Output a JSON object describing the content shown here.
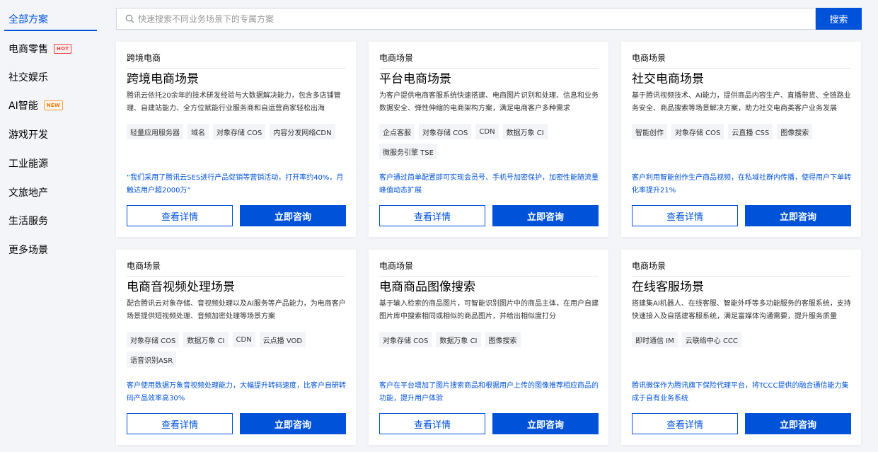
{
  "sidebar": {
    "items": [
      {
        "label": "全部方案"
      },
      {
        "label": "电商零售",
        "badge": "HOT"
      },
      {
        "label": "社交娱乐"
      },
      {
        "label": "AI智能",
        "badge": "NEW"
      },
      {
        "label": "游戏开发"
      },
      {
        "label": "工业能源"
      },
      {
        "label": "文旅地产"
      },
      {
        "label": "生活服务"
      },
      {
        "label": "更多场景"
      }
    ]
  },
  "search": {
    "placeholder": "快速搜索不同业务场景下的专属方案",
    "button_label": "搜索"
  },
  "buttons": {
    "detail_label": "查看详情",
    "consult_label": "立即咨询"
  },
  "cards": [
    {
      "tag": "跨境电商",
      "title": "跨境电商场景",
      "desc": "腾讯云依托20余年的技术研发经验与大数据解决能力，包含多店铺管理、自建站能力、全方位赋能行业服务商和自运营商家轻松出海",
      "chips": [
        "轻量应用服务器",
        "域名",
        "对象存储 COS",
        "内容分发网络CDN"
      ],
      "quote": "“我们采用了腾讯云SES进行产品促销等营销活动，打开率约40%，月触达用户超2000万”"
    },
    {
      "tag": "电商场景",
      "title": "平台电商场景",
      "desc": "为客户提供电商客服系统快速搭建、电商图片识别和处理、信息和业务数据安全、弹性伸缩的电商架构方案，满足电商客户多种需求",
      "chips": [
        "企点客服",
        "对象存储 COS",
        "CDN",
        "数据万象 CI",
        "微服务引擎 TSE"
      ],
      "quote": "客户通过简单配置即可实现会员号、手机号加密保护，加密性能随流量峰值动态扩展"
    },
    {
      "tag": "电商场景",
      "title": "社交电商场景",
      "desc": "基于腾讯视频技术、AI能力，提供商品内容生产、直播带货、全链路业务安全、商品搜索等场景解决方案，助力社交电商类客户业务发展",
      "chips": [
        "智能创作",
        "对象存储 COS",
        "云直播 CSS",
        "图像搜索"
      ],
      "quote": "客户利用智能创作生产商品视频，在私域社群内传播，使得用户下单转化率提升21%"
    },
    {
      "tag": "电商场景",
      "title": "电商音视频处理场景",
      "desc": "配合腾讯云对象存储、音视频处理以及AI服务等产品能力，为电商客户场景提供短视频处理、音频加密处理等场景方案",
      "chips": [
        "对象存储 COS",
        "数据万象 CI",
        "CDN",
        "云点播 VOD",
        "语音识别ASR"
      ],
      "quote": "客户使用数据万象音视频处理能力，大幅提升转码速度，比客户自研转码产品效率高30%"
    },
    {
      "tag": "电商场景",
      "title": "电商商品图像搜索",
      "desc": "基于输入检索的商品图片，可智能识别图片中的商品主体，在用户自建图片库中搜索相同或相似的商品图片，并给出相似度打分",
      "chips": [
        "对象存储 COS",
        "数据万象 CI",
        "图像搜索"
      ],
      "quote": "客户在平台增加了图片搜索商品和根据用户上传的图像推荐相应商品的功能，提升用户体验"
    },
    {
      "tag": "电商场景",
      "title": "在线客服场景",
      "desc": "搭建集AI机器人、在线客服、智能外呼等多功能服务的客服系统，支持快速接入及自搭建客服系统，满足富媒体沟通需要，提升服务质量",
      "chips": [
        "即时通信 IM",
        "云联络中心 CCC"
      ],
      "quote": "腾讯微保作为腾讯旗下保险代理平台，将TCCC提供的融合通信能力集成于自有业务系统"
    }
  ]
}
